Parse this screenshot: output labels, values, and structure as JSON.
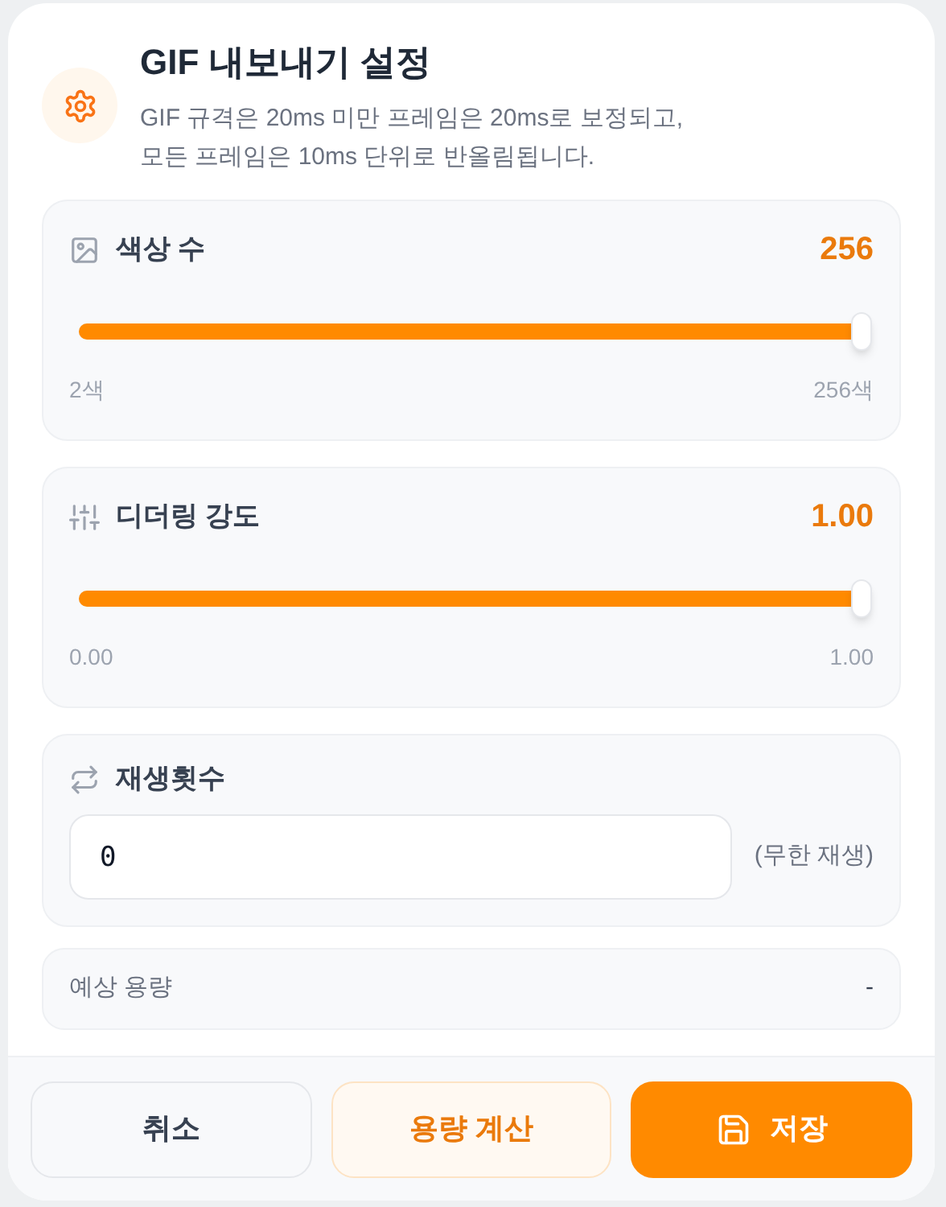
{
  "dialog": {
    "title": "GIF 내보내기 설정",
    "description": "GIF 규격은 20ms 미만 프레임은 20ms로 보정되고,\n모든 프레임은 10ms 단위로 반올림됩니다."
  },
  "settings": [
    {
      "kind": "slider",
      "label": "색상 수",
      "reading": "256",
      "level": 1,
      "min_label": "2색",
      "max_label": "256색"
    },
    {
      "kind": "slider",
      "label": "디더링 강도",
      "reading": "1.00",
      "level": 1,
      "min_label": "0.00",
      "max_label": "1.00"
    },
    {
      "kind": "number",
      "label": "재생횟수",
      "value": "0",
      "hint": "(무한 재생)"
    }
  ],
  "estimate": {
    "label": "예상 용량",
    "value": "-"
  },
  "buttons": [
    {
      "kind": "secondary",
      "label": "취소"
    },
    {
      "kind": "accent",
      "label": "용량 계산"
    },
    {
      "kind": "primary",
      "label": "저장"
    }
  ]
}
